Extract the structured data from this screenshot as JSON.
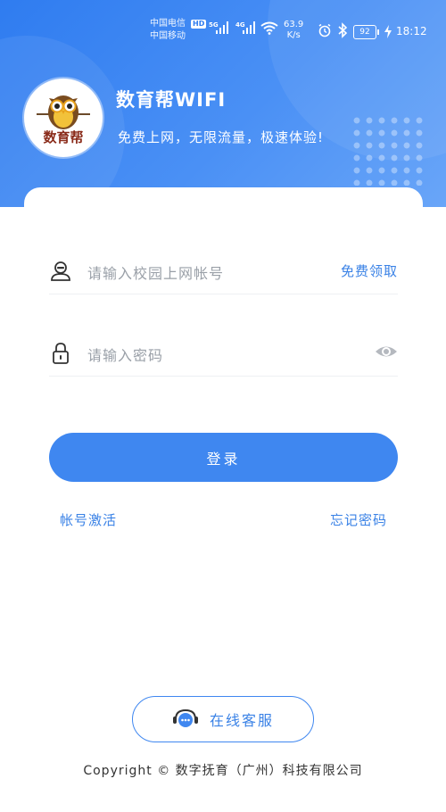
{
  "status_bar": {
    "carrier_1": "中国电信",
    "carrier_2": "中国移动",
    "hd": "HD",
    "net_1": "5G",
    "net_2": "4G",
    "speed_value": "63.9",
    "speed_unit": "K/s",
    "battery": "92",
    "time": "18:12"
  },
  "header": {
    "logo_text": "数育帮",
    "title": "数育帮WIFI",
    "slogan": "免费上网，无限流量，极速体验!"
  },
  "form": {
    "account_placeholder": "请输入校园上网帐号",
    "free_claim": "免费领取",
    "password_placeholder": "请输入密码",
    "login_label": "登录",
    "activate_link": "帐号激活",
    "forgot_link": "忘记密码"
  },
  "support": {
    "label": "在线客服"
  },
  "footer": {
    "copyright": "Copyright © 数字抚育（广州）科技有限公司"
  },
  "colors": {
    "primary": "#3f87f0",
    "link": "#3a82e6",
    "placeholder": "#9aa0a8"
  }
}
